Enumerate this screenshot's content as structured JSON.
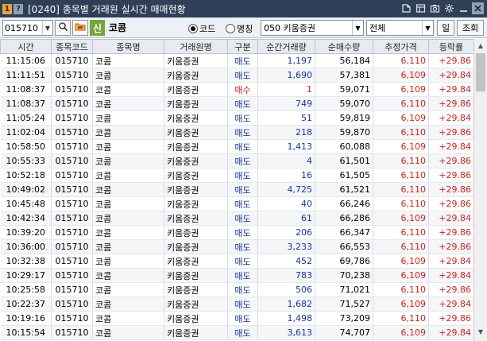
{
  "window": {
    "badge_1": "1",
    "badge_2": "?",
    "title": "[0240] 종목별 거래원 실시간 매매현황"
  },
  "toolbar": {
    "code_value": "015710",
    "shin_label": "신",
    "stock_name": "코콤",
    "radio_code_label": "코드",
    "radio_name_label": "명칭",
    "broker_value": "050 키움증권",
    "filter_value": "전체",
    "btn_il": "일",
    "btn_jo": "조회"
  },
  "table": {
    "headers": [
      "시간",
      "종목코드",
      "종목명",
      "거래원명",
      "구분",
      "순간거래량",
      "순매수량",
      "추정가격",
      "등락률"
    ],
    "rows": [
      [
        "11:15:06",
        "015710",
        "코콤",
        "키움증권",
        "매도",
        "1,197",
        "56,184",
        "6,110",
        "+29.86"
      ],
      [
        "11:11:51",
        "015710",
        "코콤",
        "키움증권",
        "매도",
        "1,690",
        "57,381",
        "6,109",
        "+29.84"
      ],
      [
        "11:08:37",
        "015710",
        "코콤",
        "키움증권",
        "매수",
        "1",
        "59,071",
        "6,109",
        "+29.84"
      ],
      [
        "11:08:37",
        "015710",
        "코콤",
        "키움증권",
        "매도",
        "749",
        "59,070",
        "6,110",
        "+29.86"
      ],
      [
        "11:05:24",
        "015710",
        "코콤",
        "키움증권",
        "매도",
        "51",
        "59,819",
        "6,109",
        "+29.84"
      ],
      [
        "11:02:04",
        "015710",
        "코콤",
        "키움증권",
        "매도",
        "218",
        "59,870",
        "6,110",
        "+29.86"
      ],
      [
        "10:58:50",
        "015710",
        "코콤",
        "키움증권",
        "매도",
        "1,413",
        "60,088",
        "6,109",
        "+29.84"
      ],
      [
        "10:55:33",
        "015710",
        "코콤",
        "키움증권",
        "매도",
        "4",
        "61,501",
        "6,110",
        "+29.86"
      ],
      [
        "10:52:18",
        "015710",
        "코콤",
        "키움증권",
        "매도",
        "16",
        "61,505",
        "6,110",
        "+29.86"
      ],
      [
        "10:49:02",
        "015710",
        "코콤",
        "키움증권",
        "매도",
        "4,725",
        "61,521",
        "6,110",
        "+29.86"
      ],
      [
        "10:45:48",
        "015710",
        "코콤",
        "키움증권",
        "매도",
        "40",
        "66,246",
        "6,110",
        "+29.86"
      ],
      [
        "10:42:34",
        "015710",
        "코콤",
        "키움증권",
        "매도",
        "61",
        "66,286",
        "6,109",
        "+29.84"
      ],
      [
        "10:39:20",
        "015710",
        "코콤",
        "키움증권",
        "매도",
        "206",
        "66,347",
        "6,110",
        "+29.86"
      ],
      [
        "10:36:00",
        "015710",
        "코콤",
        "키움증권",
        "매도",
        "3,233",
        "66,553",
        "6,110",
        "+29.86"
      ],
      [
        "10:32:38",
        "015710",
        "코콤",
        "키움증권",
        "매도",
        "452",
        "69,786",
        "6,109",
        "+29.84"
      ],
      [
        "10:29:17",
        "015710",
        "코콤",
        "키움증권",
        "매도",
        "783",
        "70,238",
        "6,109",
        "+29.84"
      ],
      [
        "10:25:58",
        "015710",
        "코콤",
        "키움증권",
        "매도",
        "506",
        "71,021",
        "6,110",
        "+29.86"
      ],
      [
        "10:22:37",
        "015710",
        "코콤",
        "키움증권",
        "매도",
        "1,682",
        "71,527",
        "6,109",
        "+29.84"
      ],
      [
        "10:19:16",
        "015710",
        "코콤",
        "키움증권",
        "매도",
        "1,498",
        "73,209",
        "6,110",
        "+29.86"
      ],
      [
        "10:15:54",
        "015710",
        "코콤",
        "키움증권",
        "매도",
        "3,613",
        "74,707",
        "6,109",
        "+29.84"
      ]
    ]
  },
  "colors": {
    "titlebar": "#2e3f57",
    "sell": "#1436a0",
    "buy": "#d2201e",
    "price_red": "#d2201e",
    "shin_badge": "#74a83a"
  },
  "icons": [
    "pin-icon",
    "layout-icon",
    "camera-icon",
    "gear-icon",
    "minimize-icon",
    "close-icon",
    "search-icon",
    "folder-icon",
    "chevron-down-icon",
    "scroll-up-icon",
    "scroll-down-icon"
  ]
}
